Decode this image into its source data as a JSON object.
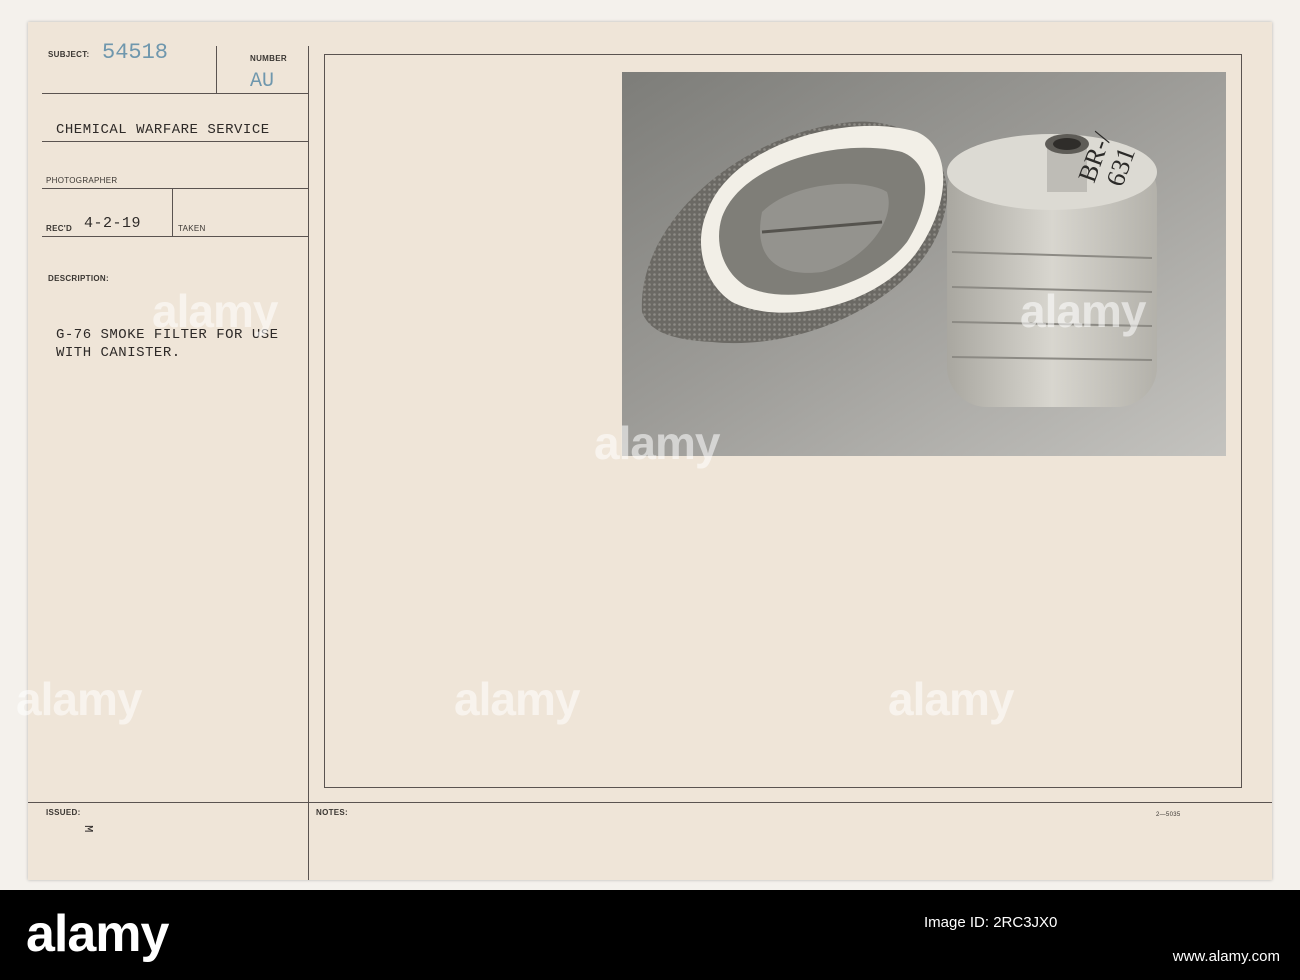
{
  "card": {
    "subject_label": "SUBJECT:",
    "subject_number": "54518",
    "number_label": "NUMBER",
    "number_value": "AU",
    "agency": "CHEMICAL WARFARE SERVICE",
    "photographer_label": "PHOTOGRAPHER",
    "recd_label": "REC'D",
    "recd_value": "4-2-19",
    "taken_label": "TAKEN",
    "description_label": "DESCRIPTION:",
    "description_line1": "G-76 SMOKE FILTER FOR USE",
    "description_line2": "WITH CANISTER.",
    "issued_label": "ISSUED:",
    "issued_mark": "M",
    "notes_label": "NOTES:",
    "form_code": "2—5035"
  },
  "photo": {
    "canister_marking_line1": "BR-/",
    "canister_marking_line2": "631"
  },
  "watermark": {
    "brand": "alamy",
    "image_id_label": "Image ID: 2RC3JX0",
    "website": "www.alamy.com"
  },
  "colors": {
    "paper": "#efe5d8",
    "ink": "#2e2a28",
    "stamp_blue": "#6f97ad",
    "footer": "#000000"
  }
}
